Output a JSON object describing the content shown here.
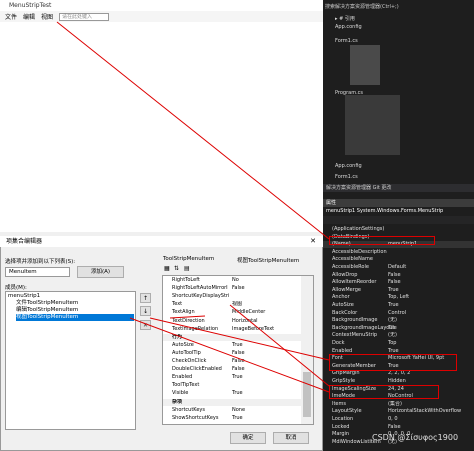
{
  "form": {
    "title": "MenuStripTest",
    "menu": [
      "文件",
      "编辑",
      "视图"
    ],
    "combo_placeholder": "请在此处键入"
  },
  "ide": {
    "search": "搜索解决方案资源管理器(Ctrl+;)",
    "tree": [
      "▸ # 引用",
      "App.config",
      "Form1.cs",
      "Program.cs",
      "App.config",
      "Form1.cs"
    ],
    "tabs": "解决方案资源管理器  Git 更改",
    "props_header": "属性",
    "props_object": "menuStrip1 System.Windows.Forms.MenuStrip",
    "properties": [
      {
        "n": "(ApplicationSettings)",
        "v": ""
      },
      {
        "n": "(DataBindings)",
        "v": ""
      },
      {
        "n": "(Name)",
        "v": "menuStrip1"
      },
      {
        "n": "AccessibleDescription",
        "v": ""
      },
      {
        "n": "AccessibleName",
        "v": ""
      },
      {
        "n": "AccessibleRole",
        "v": "Default"
      },
      {
        "n": "AllowDrop",
        "v": "False"
      },
      {
        "n": "AllowItemReorder",
        "v": "False"
      },
      {
        "n": "AllowMerge",
        "v": "True"
      },
      {
        "n": "Anchor",
        "v": "Top, Left"
      },
      {
        "n": "AutoSize",
        "v": "True"
      },
      {
        "n": "BackColor",
        "v": "Control"
      },
      {
        "n": "BackgroundImage",
        "v": "(无)"
      },
      {
        "n": "BackgroundImageLayout",
        "v": "Tile"
      },
      {
        "n": "ContextMenuStrip",
        "v": "(无)"
      },
      {
        "n": "Dock",
        "v": "Top"
      },
      {
        "n": "Enabled",
        "v": "True"
      },
      {
        "n": "Font",
        "v": "Microsoft YaHei UI, 9pt"
      },
      {
        "n": "GenerateMember",
        "v": "True"
      },
      {
        "n": "GripMargin",
        "v": "2, 2, 0, 2"
      },
      {
        "n": "GripStyle",
        "v": "Hidden"
      },
      {
        "n": "ImageScalingSize",
        "v": "24, 24"
      },
      {
        "n": "ImeMode",
        "v": "NoControl"
      },
      {
        "n": "Items",
        "v": "(集合)"
      },
      {
        "n": "LayoutStyle",
        "v": "HorizontalStackWithOverflow"
      },
      {
        "n": "Location",
        "v": "0, 0"
      },
      {
        "n": "Locked",
        "v": "False"
      },
      {
        "n": "Margin",
        "v": "0, 0, 0, 0"
      },
      {
        "n": "MdiWindowListItem",
        "v": "(无)"
      }
    ]
  },
  "dialog": {
    "title": "项集合编辑器",
    "select_label": "选择项并添加到以下列表(S):",
    "type_value": "MenuItem",
    "add_button": "添加(A)",
    "members_label": "成员(M):",
    "members": [
      "menuStrip1",
      "文件ToolStripMenuItem",
      "编辑ToolStripMenuItem",
      "视图ToolStripMenuItem"
    ],
    "pg_title": "ToolStripMenuItem",
    "pg_title2": "视图ToolStripMenuItem",
    "props": [
      {
        "n": "RightToLeft",
        "v": "No",
        "cat": false
      },
      {
        "n": "RightToLeftAutoMirrorI",
        "v": "False",
        "cat": false
      },
      {
        "n": "ShortcutKeyDisplayStri",
        "v": "",
        "cat": false
      },
      {
        "n": "Text",
        "v": "视图",
        "cat": false
      },
      {
        "n": "TextAlign",
        "v": "MiddleCenter",
        "cat": false
      },
      {
        "n": "TextDirection",
        "v": "Horizontal",
        "cat": false
      },
      {
        "n": "TextImageRelation",
        "v": "ImageBeforeText",
        "cat": false
      },
      {
        "n": "行为",
        "v": "",
        "cat": true
      },
      {
        "n": "AutoSize",
        "v": "True",
        "cat": false
      },
      {
        "n": "AutoToolTip",
        "v": "False",
        "cat": false
      },
      {
        "n": "CheckOnClick",
        "v": "False",
        "cat": false
      },
      {
        "n": "DoubleClickEnabled",
        "v": "False",
        "cat": false
      },
      {
        "n": "Enabled",
        "v": "True",
        "cat": false
      },
      {
        "n": "ToolTipText",
        "v": "",
        "cat": false
      },
      {
        "n": "Visible",
        "v": "True",
        "cat": false
      },
      {
        "n": "杂项",
        "v": "",
        "cat": true
      },
      {
        "n": "ShortcutKeys",
        "v": "None",
        "cat": false
      },
      {
        "n": "ShowShortcutKeys",
        "v": "True",
        "cat": false
      }
    ],
    "ok_button": "确定",
    "cancel_button": "取消"
  },
  "watermark": "CSDN @Σίσυφος1900"
}
